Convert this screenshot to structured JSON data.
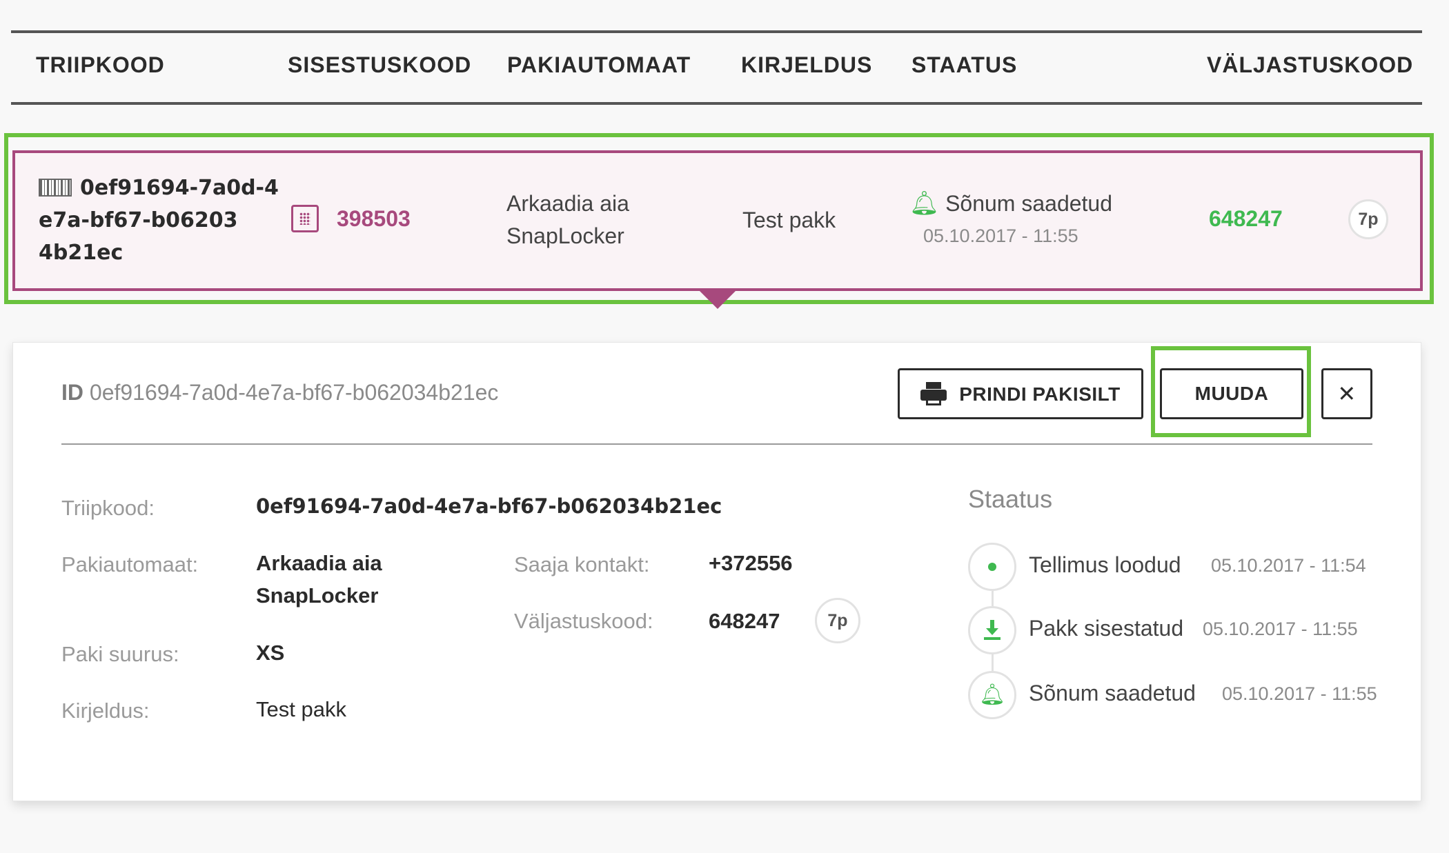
{
  "table": {
    "headers": [
      "TRIIPKOOD",
      "SISESTUSKOOD",
      "PAKIAUTOMAAT",
      "KIRJELDUS",
      "STAATUS",
      "VÄLJASTUSKOOD"
    ]
  },
  "row": {
    "barcode_lines": [
      "0ef91694-7a0d-4",
      "e7a-bf67-b06203",
      "4b21ec"
    ],
    "input_code": "398503",
    "locker_lines": [
      "Arkaadia aia",
      "SnapLocker"
    ],
    "description": "Test pakk",
    "status_text": "Sõnum saadetud",
    "status_time": "05.10.2017 - 11:55",
    "release_code": "648247",
    "days_badge": "7p"
  },
  "detail": {
    "id_label": "ID",
    "id_value": "0ef91694-7a0d-4e7a-bf67-b062034b21ec",
    "print_button": "PRINDI PAKISILT",
    "edit_button": "MUUDA",
    "close_symbol": "✕",
    "fields": {
      "barcode_label": "Triipkood:",
      "barcode_value": "0ef91694-7a0d-4e7a-bf67-b062034b21ec",
      "locker_label": "Pakiautomaat:",
      "locker_lines": [
        "Arkaadia aia",
        "SnapLocker"
      ],
      "size_label": "Paki suurus:",
      "size_value": "XS",
      "description_label": "Kirjeldus:",
      "description_value": "Test pakk",
      "contact_label": "Saaja kontakt:",
      "contact_value": "+372556",
      "release_label": "Väljastuskood:",
      "release_value": "648247",
      "days_badge": "7p"
    },
    "status": {
      "title": "Staatus",
      "events": [
        {
          "icon": "dot-icon",
          "text": "Tellimus loodud",
          "time": "05.10.2017 - 11:54"
        },
        {
          "icon": "download-icon",
          "text": "Pakk sisestatud",
          "time": "05.10.2017 - 11:55"
        },
        {
          "icon": "bell-icon",
          "text": "Sõnum saadetud",
          "time": "05.10.2017 - 11:55"
        }
      ]
    }
  },
  "colors": {
    "accent_magenta": "#a7497d",
    "accent_green": "#3fb950",
    "highlight_green": "#6ac23e"
  }
}
